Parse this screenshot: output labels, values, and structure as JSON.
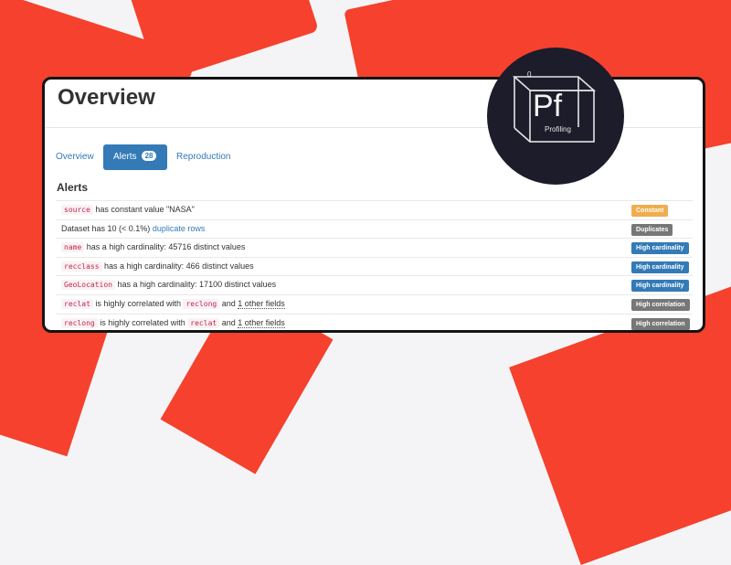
{
  "colors": {
    "accent_red": "#f5412d",
    "link_blue": "#337ab7",
    "logo_bg": "#1c1c2a",
    "constant_badge": "#f0ad4e",
    "duplicates_badge": "#777777",
    "high_cardinality_badge": "#337ab7",
    "high_correlation_badge": "#777777"
  },
  "logo": {
    "symbol": "Pf",
    "number": "0",
    "caption": "Profiling",
    "icon": "pf-cube-icon"
  },
  "header": {
    "title": "Overview"
  },
  "tabs": [
    {
      "label": "Overview"
    },
    {
      "label": "Alerts",
      "count": "28",
      "active": true
    },
    {
      "label": "Reproduction"
    }
  ],
  "alerts_section": {
    "heading": "Alerts",
    "rows": [
      {
        "field": "source",
        "text": "has constant value \"NASA\"",
        "badge": "Constant"
      },
      {
        "prefix": "Dataset has 10 (< 0.1%)",
        "link": "duplicate rows",
        "badge": "Duplicates"
      },
      {
        "field": "name",
        "text": "has a high cardinality: 45716 distinct values",
        "badge": "High cardinality"
      },
      {
        "field": "recclass",
        "text": "has a high cardinality: 466 distinct values",
        "badge": "High cardinality"
      },
      {
        "field": "GeoLocation",
        "text": "has a high cardinality: 17100 distinct values",
        "badge": "High cardinality"
      },
      {
        "field": "reclat",
        "middle": "is highly correlated with",
        "field2": "reclong",
        "and": "and",
        "other": "1 other fields",
        "badge": "High correlation"
      },
      {
        "field": "reclong",
        "middle": "is highly correlated with",
        "field2": "reclat",
        "and": "and",
        "other": "1 other fields",
        "badge": "High correlation"
      }
    ]
  }
}
